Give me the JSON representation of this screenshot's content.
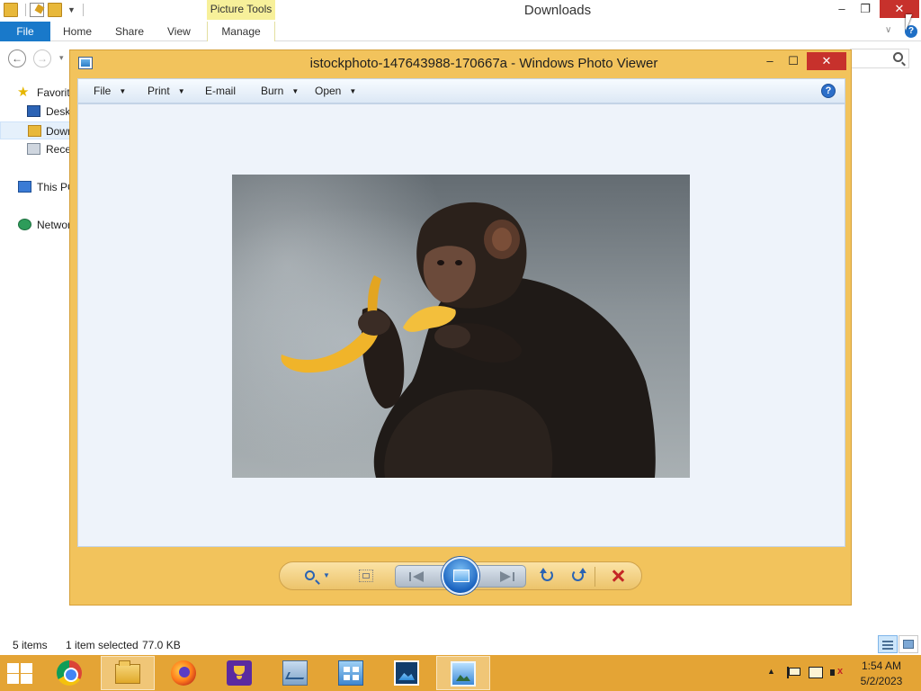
{
  "explorer": {
    "title": "Downloads",
    "context_tab": "Picture Tools",
    "window_controls": {
      "minimize": "–",
      "maximize": "❐",
      "close": "✕"
    },
    "ribbon_tabs": [
      "File",
      "Home",
      "Share",
      "View",
      "Manage"
    ],
    "help_glyph": "?",
    "chevron_glyph": "∨",
    "nav": {
      "back": "←",
      "forward": "→",
      "dropdown": "▾"
    },
    "nav_pane": {
      "favorites": "Favorites",
      "desktop": "Desktop",
      "downloads": "Downloads",
      "recent": "Recent places",
      "this_pc": "This PC",
      "network": "Network"
    },
    "status": {
      "items": "5 items",
      "selected": "1 item selected",
      "size": "77.0 KB"
    }
  },
  "viewer": {
    "title": "istockphoto-147643988-170667a - Windows Photo Viewer",
    "window_controls": {
      "minimize": "–",
      "maximize": "☐",
      "close": "✕"
    },
    "menus": {
      "file": "File",
      "print": "Print",
      "email": "E-mail",
      "burn": "Burn",
      "open": "Open"
    },
    "menu_arrow": "▼",
    "help_glyph": "?",
    "zoom_dropdown": "▼",
    "photo": {
      "subject_icon": "chimpanzee-eating-banana-photo"
    }
  },
  "taskbar": {
    "apps": [
      "chrome",
      "file-explorer",
      "firefox",
      "trophy-app",
      "performance-monitor",
      "control-panel",
      "photos",
      "windows-photo-viewer"
    ],
    "tray_up": "▲",
    "time": "1:54 AM",
    "date": "5/2/2023"
  },
  "colors": {
    "viewer_frame": "#f2c35c",
    "taskbar": "#e4a435",
    "explorer_file_tab": "#1979ca",
    "close_button": "#c7312c",
    "context_tab": "#f7f09a"
  }
}
